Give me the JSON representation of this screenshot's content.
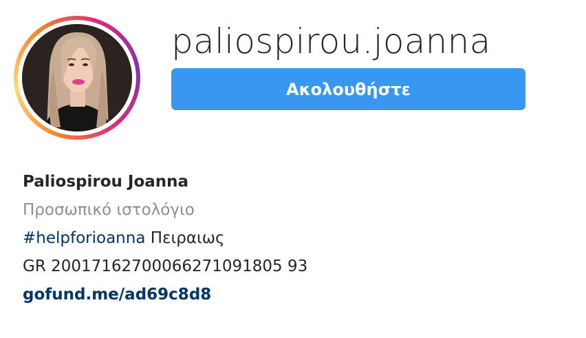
{
  "profile": {
    "username": "paliospirou.joanna",
    "follow_label": "Ακολουθήστε",
    "full_name": "Paliospirou Joanna",
    "category": "Προσωπικό ιστολόγιο",
    "bio_hashtag": "#helpforioanna",
    "bio_hashtag_suffix": " Πειραιως",
    "bio_iban": "GR 20017162700066271091805 93",
    "website": "gofund.me/ad69c8d8"
  },
  "colors": {
    "follow_button": "#3897f0",
    "link": "#003569",
    "secondary_text": "#8e8e8e"
  },
  "icons": {
    "avatar": "profile-illustration"
  }
}
